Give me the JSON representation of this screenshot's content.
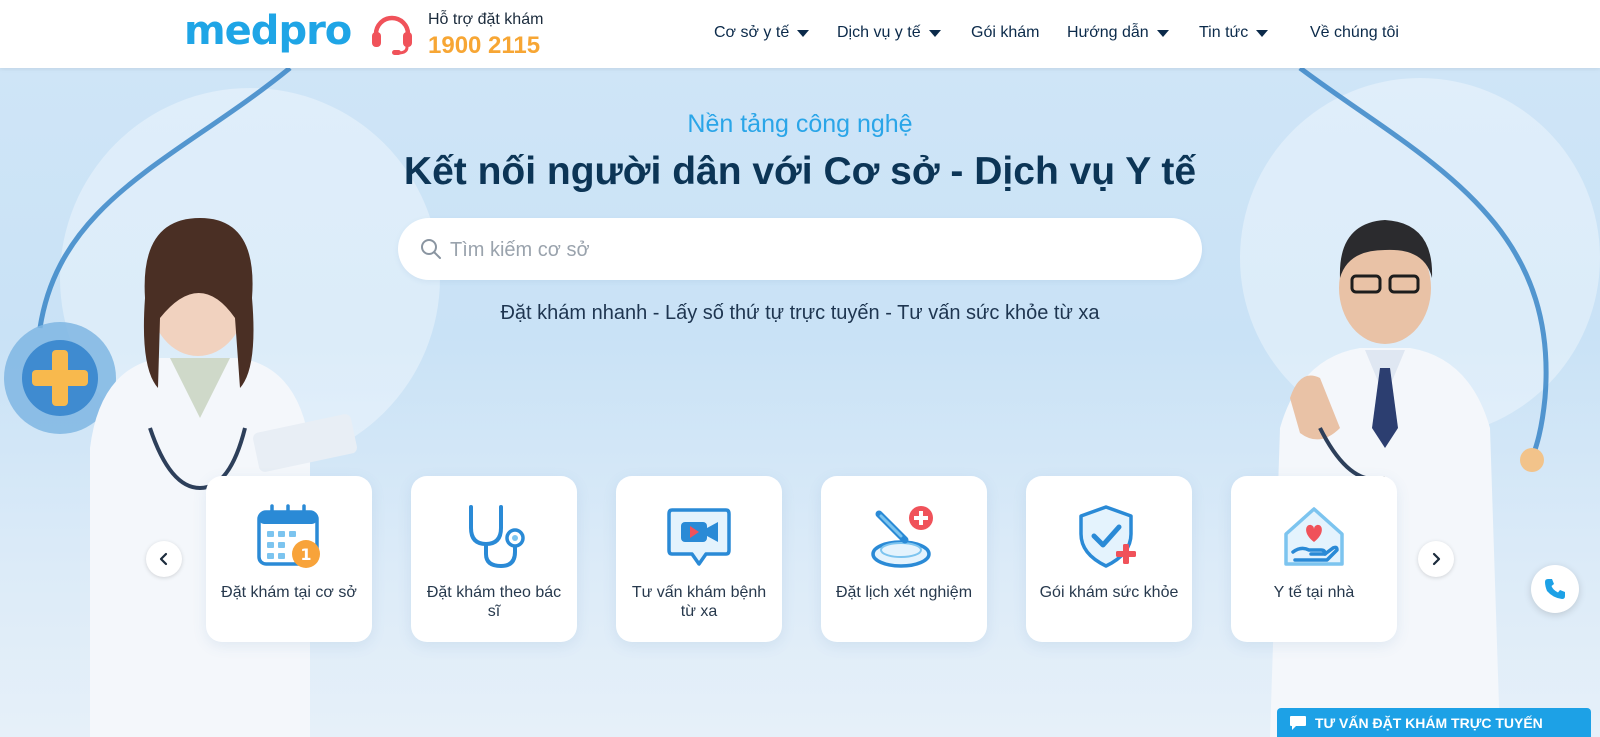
{
  "header": {
    "logo": "medpro",
    "hotline_label": "Hỗ trợ đặt khám",
    "hotline_number": "1900 2115",
    "nav": [
      {
        "label": "Cơ sở y tế",
        "dropdown": true
      },
      {
        "label": "Dịch vụ y tế",
        "dropdown": true
      },
      {
        "label": "Gói khám",
        "dropdown": false
      },
      {
        "label": "Hướng dẫn",
        "dropdown": true
      },
      {
        "label": "Tin tức",
        "dropdown": true
      },
      {
        "label": "Về chúng tôi",
        "dropdown": false
      }
    ]
  },
  "hero": {
    "subtitle": "Nền tảng công nghệ",
    "title": "Kết nối người dân với Cơ sở - Dịch vụ Y tế",
    "search_placeholder": "Tìm kiếm cơ sở",
    "tagline": "Đặt khám nhanh - Lấy số thứ tự trực tuyến - Tư vấn sức khỏe từ xa"
  },
  "services": [
    {
      "label": "Đặt khám tại cơ sở",
      "icon": "calendar-icon"
    },
    {
      "label": "Đặt khám theo bác sĩ",
      "icon": "stethoscope-icon"
    },
    {
      "label": "Tư vấn khám bệnh từ xa",
      "icon": "video-call-icon"
    },
    {
      "label": "Đặt lịch xét nghiệm",
      "icon": "test-tube-icon"
    },
    {
      "label": "Gói khám sức khỏe",
      "icon": "shield-check-icon"
    },
    {
      "label": "Y tế tại nhà",
      "icon": "home-care-icon"
    }
  ],
  "chat": {
    "label": "TƯ VẤN ĐẶT KHÁM TRỰC TUYẾN"
  },
  "colors": {
    "brand": "#1fa5e6",
    "hotline": "#f7a634",
    "title": "#0c3556",
    "accent_red": "#f0525a"
  }
}
